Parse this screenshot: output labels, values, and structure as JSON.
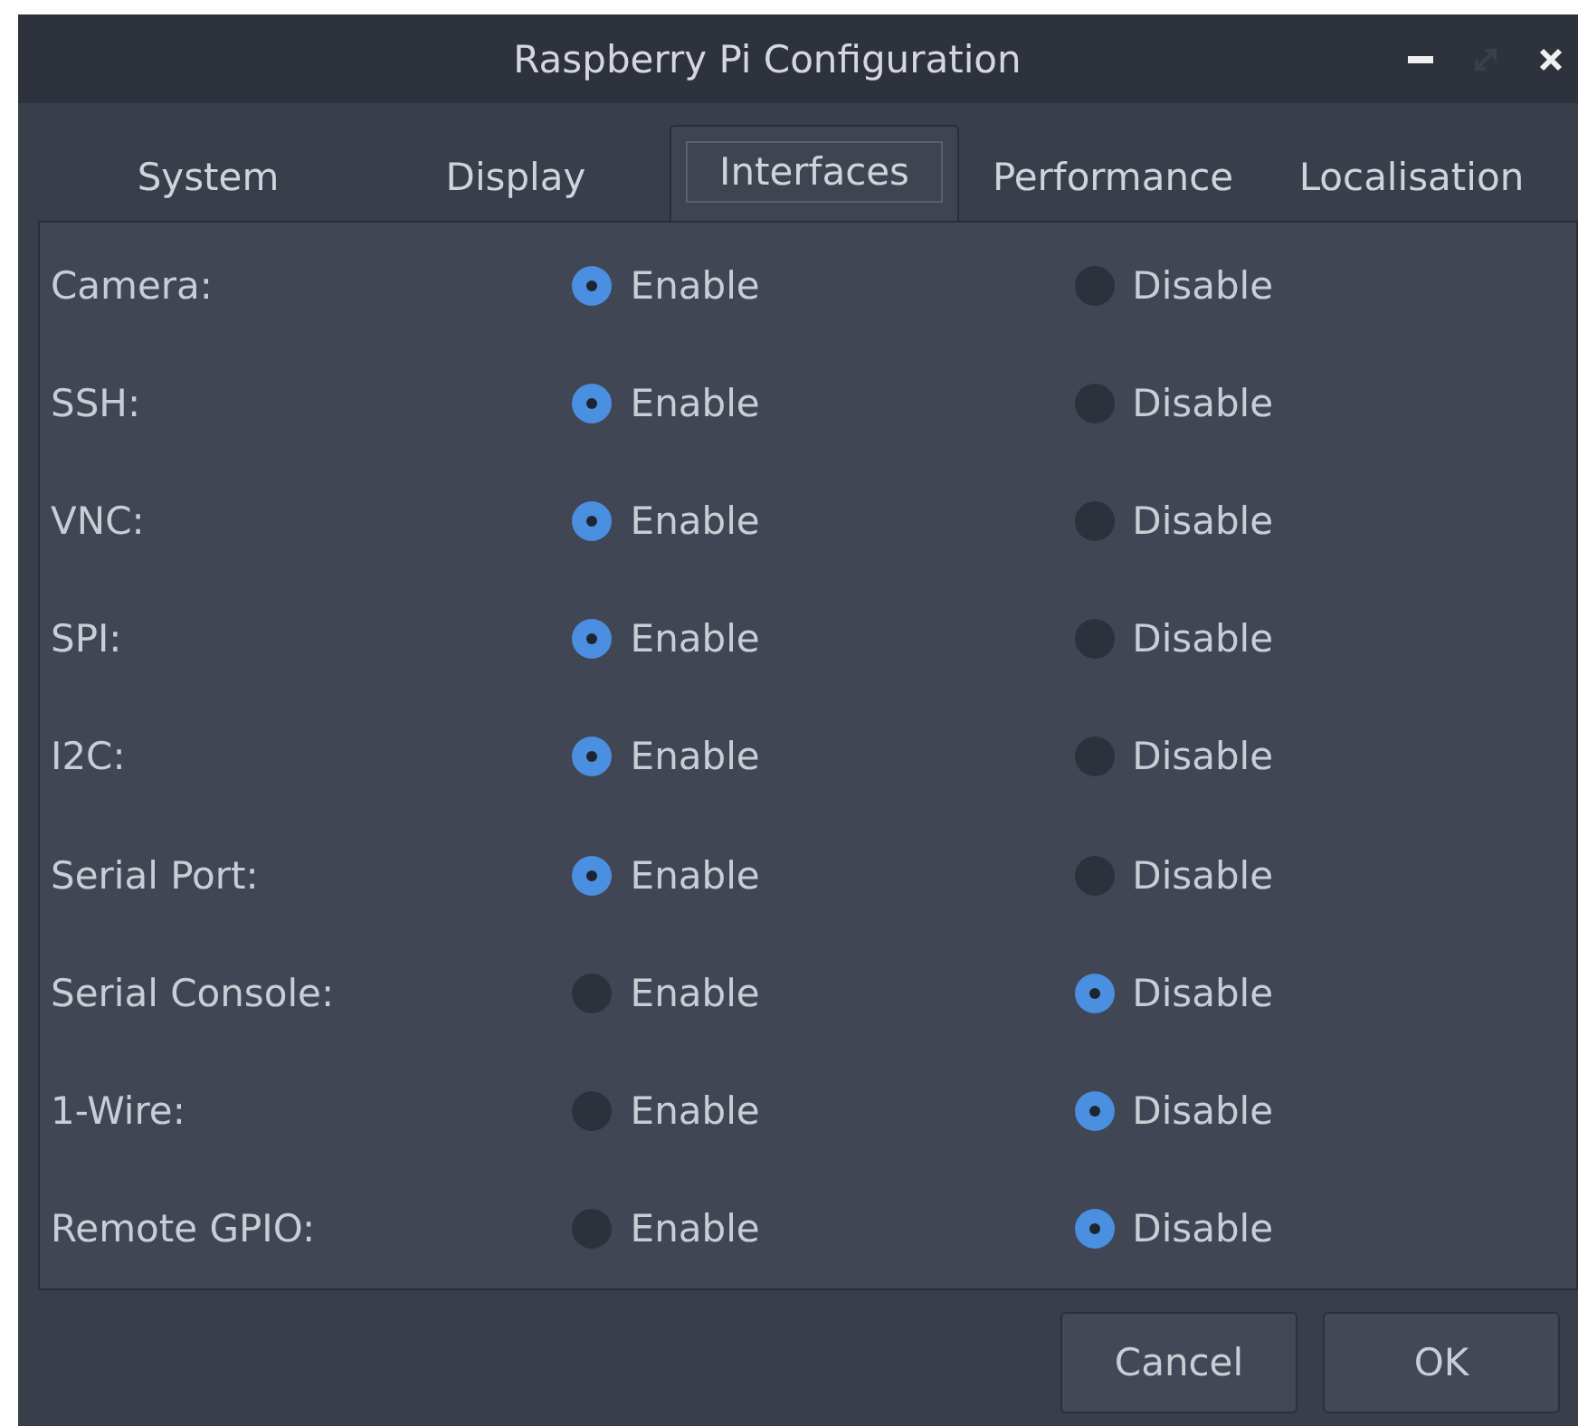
{
  "window": {
    "title": "Raspberry Pi Configuration"
  },
  "tabs": [
    {
      "label": "System",
      "selected": false
    },
    {
      "label": "Display",
      "selected": false
    },
    {
      "label": "Interfaces",
      "selected": true
    },
    {
      "label": "Performance",
      "selected": false
    },
    {
      "label": "Localisation",
      "selected": false
    }
  ],
  "settings": [
    {
      "label": "Camera:",
      "options": [
        {
          "label": "Enable",
          "selected": true
        },
        {
          "label": "Disable",
          "selected": false
        }
      ]
    },
    {
      "label": "SSH:",
      "options": [
        {
          "label": "Enable",
          "selected": true
        },
        {
          "label": "Disable",
          "selected": false
        }
      ]
    },
    {
      "label": "VNC:",
      "options": [
        {
          "label": "Enable",
          "selected": true
        },
        {
          "label": "Disable",
          "selected": false
        }
      ]
    },
    {
      "label": "SPI:",
      "options": [
        {
          "label": "Enable",
          "selected": true
        },
        {
          "label": "Disable",
          "selected": false
        }
      ]
    },
    {
      "label": "I2C:",
      "options": [
        {
          "label": "Enable",
          "selected": true
        },
        {
          "label": "Disable",
          "selected": false
        }
      ]
    },
    {
      "label": "Serial Port:",
      "options": [
        {
          "label": "Enable",
          "selected": true
        },
        {
          "label": "Disable",
          "selected": false
        }
      ]
    },
    {
      "label": "Serial Console:",
      "options": [
        {
          "label": "Enable",
          "selected": false
        },
        {
          "label": "Disable",
          "selected": true
        }
      ]
    },
    {
      "label": "1-Wire:",
      "options": [
        {
          "label": "Enable",
          "selected": false
        },
        {
          "label": "Disable",
          "selected": true
        }
      ]
    },
    {
      "label": "Remote GPIO:",
      "options": [
        {
          "label": "Enable",
          "selected": false
        },
        {
          "label": "Disable",
          "selected": true
        }
      ]
    }
  ],
  "buttons": [
    "Cancel",
    "OK"
  ]
}
